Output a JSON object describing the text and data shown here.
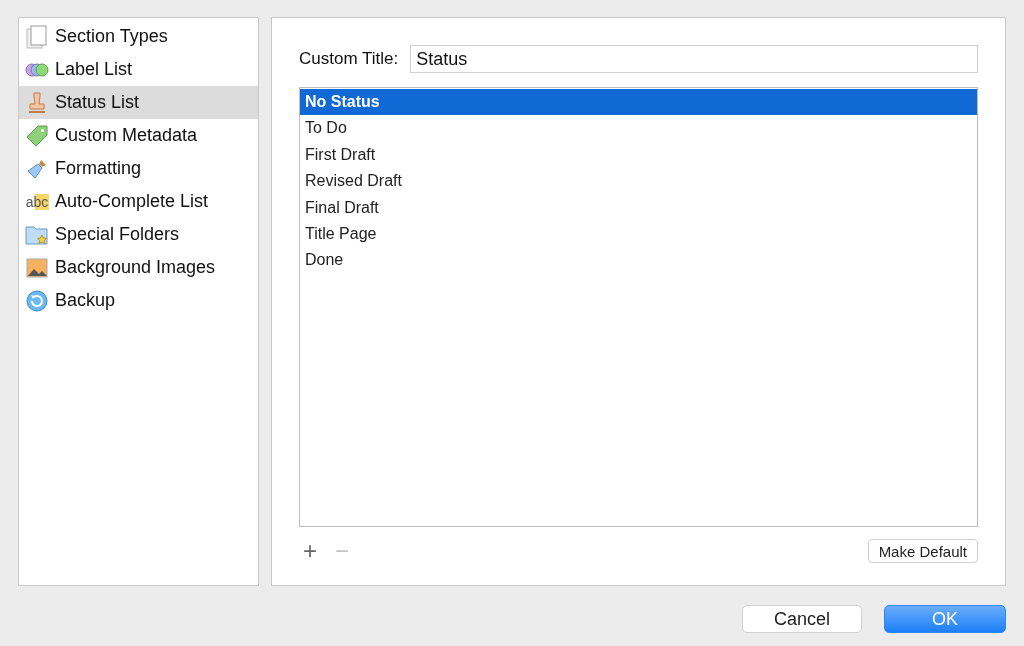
{
  "sidebar": {
    "items": [
      {
        "label": "Section Types",
        "selected": false
      },
      {
        "label": "Label List",
        "selected": false
      },
      {
        "label": "Status List",
        "selected": true
      },
      {
        "label": "Custom Metadata",
        "selected": false
      },
      {
        "label": "Formatting",
        "selected": false
      },
      {
        "label": "Auto-Complete List",
        "selected": false,
        "icon_text": "abc"
      },
      {
        "label": "Special Folders",
        "selected": false
      },
      {
        "label": "Background Images",
        "selected": false
      },
      {
        "label": "Backup",
        "selected": false
      }
    ]
  },
  "custom_title": {
    "label": "Custom Title:",
    "value": "Status"
  },
  "status_list": [
    {
      "label": "No Status",
      "selected": true
    },
    {
      "label": "To Do",
      "selected": false
    },
    {
      "label": "First Draft",
      "selected": false
    },
    {
      "label": "Revised Draft",
      "selected": false
    },
    {
      "label": "Final Draft",
      "selected": false
    },
    {
      "label": "Title Page",
      "selected": false
    },
    {
      "label": "Done",
      "selected": false
    }
  ],
  "list_controls": {
    "add": {
      "symbol": "+",
      "disabled": false
    },
    "remove": {
      "symbol": "−",
      "disabled": true
    },
    "make_default": "Make Default"
  },
  "buttons": {
    "cancel": "Cancel",
    "ok": "OK"
  }
}
